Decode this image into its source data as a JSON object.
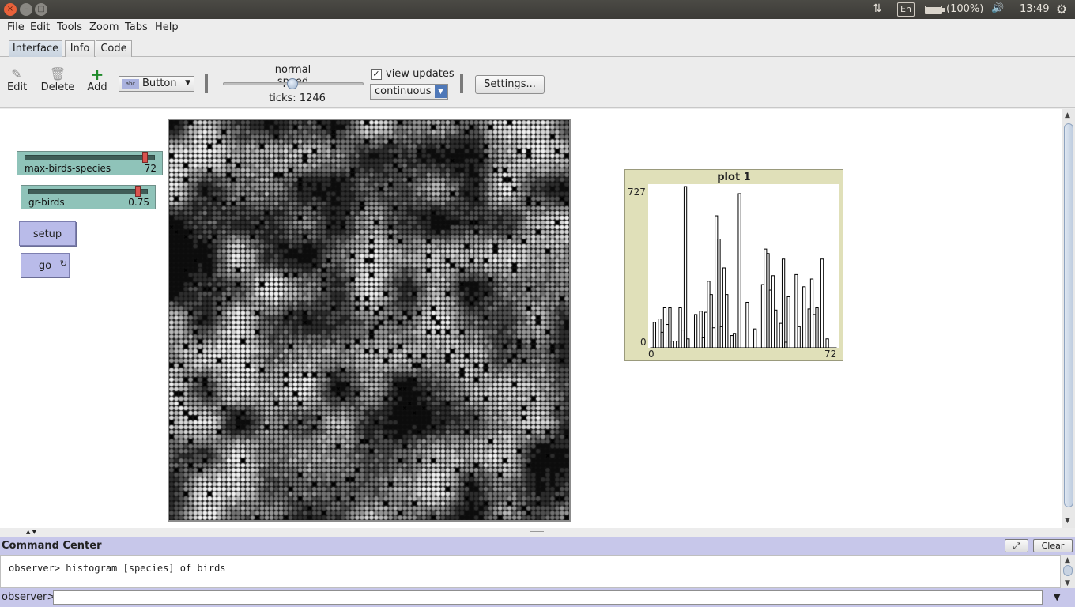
{
  "system": {
    "window_buttons": [
      "×",
      "–",
      "□"
    ],
    "tray": {
      "network": "⇅",
      "language": "En",
      "battery_level": 1.0,
      "battery_text": "(100%)",
      "volume": "🔊",
      "time": "13:49",
      "power": "⚙"
    }
  },
  "menubar": {
    "items": [
      "File",
      "Edit",
      "Tools",
      "Zoom",
      "Tabs",
      "Help"
    ]
  },
  "tabs": {
    "items": [
      "Interface",
      "Info",
      "Code"
    ],
    "active": "Interface"
  },
  "toolbar": {
    "edit_label": "Edit",
    "delete_label": "Delete",
    "add_label": "Add",
    "widget_type": "Button",
    "speed_label": "normal speed",
    "ticks_label": "ticks: 1246",
    "view_updates_label": "view updates",
    "view_updates_checked": true,
    "update_mode": "continuous",
    "settings_label": "Settings..."
  },
  "widgets": {
    "max_birds_species": {
      "name": "max-birds-species",
      "value": "72",
      "fraction": 0.93
    },
    "gr_birds": {
      "name": "gr-birds",
      "value": "0.75",
      "fraction": 0.92
    },
    "setup_label": "setup",
    "go_label": "go",
    "go_forever_icon": "↻"
  },
  "plot": {
    "title": "plot 1",
    "y_max_label": "727",
    "y_min_label": "0",
    "x_min_label": "0",
    "x_max_label": "72"
  },
  "chart_data": {
    "type": "bar",
    "title": "plot 1",
    "xlim": [
      0,
      72
    ],
    "ylim": [
      0,
      727
    ],
    "values": [
      0,
      115,
      0,
      130,
      70,
      180,
      105,
      180,
      30,
      0,
      30,
      180,
      80,
      727,
      40,
      0,
      0,
      150,
      0,
      165,
      45,
      160,
      300,
      240,
      90,
      595,
      490,
      95,
      360,
      240,
      0,
      55,
      65,
      0,
      695,
      0,
      0,
      205,
      0,
      0,
      85,
      0,
      0,
      285,
      445,
      425,
      260,
      325,
      170,
      0,
      110,
      400,
      25,
      230,
      0,
      0,
      330,
      95,
      0,
      275,
      0,
      175,
      310,
      150,
      180,
      0,
      400,
      0,
      40,
      0,
      0,
      0
    ]
  },
  "command_center": {
    "title": "Command Center",
    "expand_icon": "⤢",
    "clear_label": "Clear",
    "output_line": "observer> histogram [species] of birds",
    "prompt": "observer>",
    "input_value": ""
  }
}
